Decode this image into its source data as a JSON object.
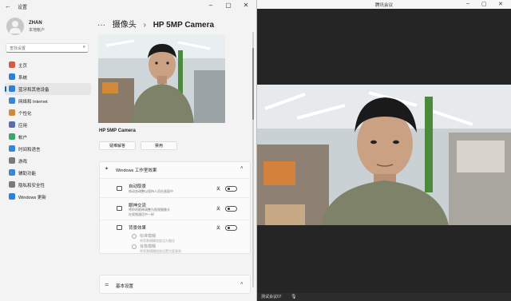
{
  "settings": {
    "window_title": "设置",
    "user": {
      "name": "ZHAN",
      "account": "本地帐户"
    },
    "search": {
      "placeholder": "查找设置"
    },
    "nav": [
      {
        "label": "主页",
        "icon": "home-icon",
        "color": "#d8594a"
      },
      {
        "label": "系统",
        "icon": "system-icon",
        "color": "#2f7fd6"
      },
      {
        "label": "蓝牙和其他设备",
        "icon": "bluetooth-icon",
        "color": "#2f7fd6",
        "active": true
      },
      {
        "label": "网络和 Internet",
        "icon": "network-icon",
        "color": "#3a86d0"
      },
      {
        "label": "个性化",
        "icon": "personalization-icon",
        "color": "#d08a3a"
      },
      {
        "label": "应用",
        "icon": "apps-icon",
        "color": "#5a6ea8"
      },
      {
        "label": "帐户",
        "icon": "accounts-icon",
        "color": "#3aa56d"
      },
      {
        "label": "时间和语言",
        "icon": "time-language-icon",
        "color": "#3a86d0"
      },
      {
        "label": "游戏",
        "icon": "gaming-icon",
        "color": "#7a7a7a"
      },
      {
        "label": "辅助功能",
        "icon": "accessibility-icon",
        "color": "#3a86d0"
      },
      {
        "label": "隐私和安全性",
        "icon": "privacy-icon",
        "color": "#7a7a7a"
      },
      {
        "label": "Windows 更新",
        "icon": "windows-update-icon",
        "color": "#2f7fd6"
      }
    ],
    "breadcrumb": {
      "more": "···",
      "parent": "摄像头",
      "separator": "›",
      "current": "HP 5MP Camera"
    },
    "camera_name": "HP 5MP Camera",
    "buttons": {
      "troubleshoot": "疑难解答",
      "disable": "禁用"
    },
    "studio": {
      "title": "Windows 工作室效果",
      "rows": [
        {
          "title": "自动取景",
          "desc": "帧动态调整以保持人员在画面中",
          "state": "关"
        },
        {
          "title": "眼神交流",
          "desc": "将你的眼神调整为直视摄像头",
          "desc2": "在视频通话中一样",
          "state": "关"
        },
        {
          "title": "背景效果",
          "desc": "",
          "state": "关"
        }
      ],
      "radios": [
        {
          "title": "标准模糊",
          "desc": "将背景模糊程度设为最佳"
        },
        {
          "title": "肖像模糊",
          "desc": "将背景模糊程度设置为更柔和"
        }
      ]
    },
    "basic_settings": {
      "title": "基本设置"
    }
  },
  "meeting": {
    "window_title": "腾讯会议",
    "participant": "测试会议07"
  }
}
